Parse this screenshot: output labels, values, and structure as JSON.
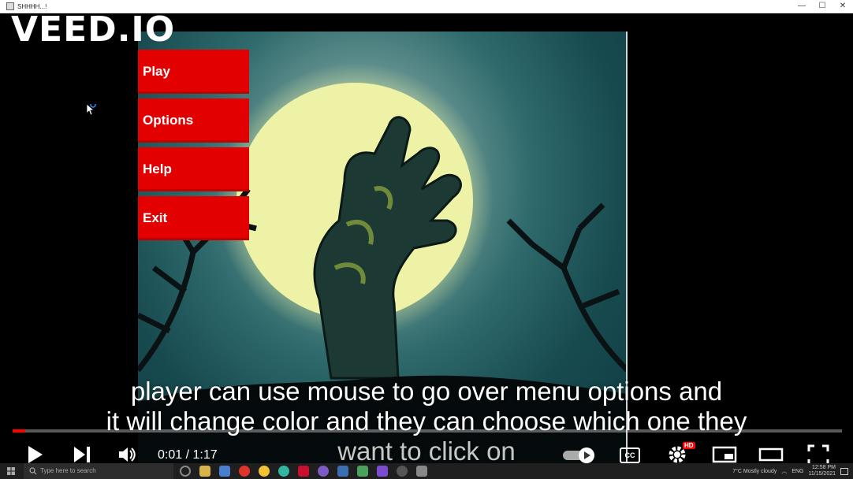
{
  "window": {
    "title": "SHHHH...!",
    "minimize": "—",
    "maximize": "☐",
    "close": "✕"
  },
  "watermark": "VEED.IO",
  "menu": {
    "items": [
      {
        "label": "Play"
      },
      {
        "label": "Options"
      },
      {
        "label": "Help"
      },
      {
        "label": "Exit"
      }
    ],
    "button_color": "#e30000"
  },
  "captions": {
    "line1": "player can use mouse to go over menu options and",
    "line2": "it will change color and they can choose which one they",
    "line3": "want to click on"
  },
  "player": {
    "time_display": "0:01 / 1:17",
    "progress": 0.015,
    "hd_badge": "HD",
    "cc_label": "CC",
    "accent": "#ff0000"
  },
  "taskbar": {
    "search_placeholder": "Type here to search",
    "weather": "7°C  Mostly cloudy",
    "lang": "ENG",
    "time": "12:58 PM",
    "date": "11/15/2021"
  }
}
